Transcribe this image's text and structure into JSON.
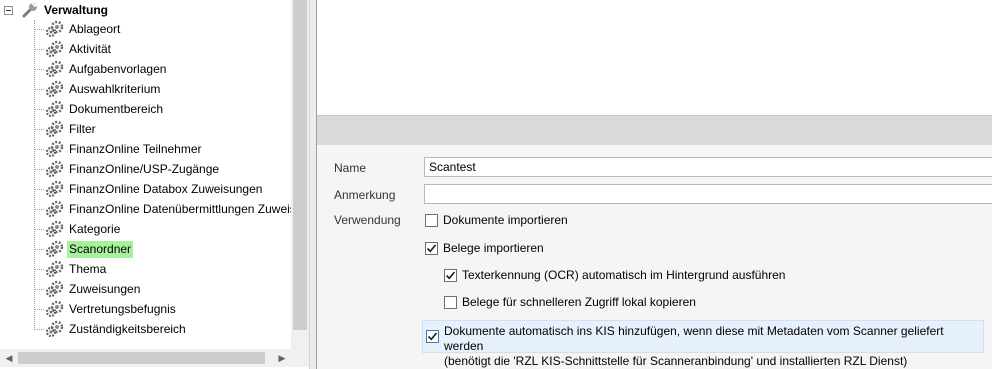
{
  "tree": {
    "root_label": "Verwaltung",
    "items": [
      {
        "label": "Ablageort"
      },
      {
        "label": "Aktivität"
      },
      {
        "label": "Aufgabenvorlagen"
      },
      {
        "label": "Auswahlkriterium"
      },
      {
        "label": "Dokumentbereich"
      },
      {
        "label": "Filter"
      },
      {
        "label": "FinanzOnline Teilnehmer"
      },
      {
        "label": "FinanzOnline/USP-Zugänge"
      },
      {
        "label": "FinanzOnline Databox Zuweisungen"
      },
      {
        "label": "FinanzOnline Datenübermittlungen Zuweisungen"
      },
      {
        "label": "Kategorie"
      },
      {
        "label": "Scanordner",
        "selected": true
      },
      {
        "label": "Thema"
      },
      {
        "label": "Zuweisungen"
      },
      {
        "label": "Vertretungsbefugnis"
      },
      {
        "label": "Zuständigkeitsbereich"
      }
    ],
    "selection_color": "#a6f19e"
  },
  "form": {
    "name_label": "Name",
    "name_value": "Scantest",
    "anmerkung_label": "Anmerkung",
    "anmerkung_value": "",
    "verwendung_label": "Verwendung",
    "options": {
      "dokumente_importieren": {
        "label": "Dokumente importieren",
        "checked": false
      },
      "belege_importieren": {
        "label": "Belege importieren",
        "checked": true
      },
      "ocr": {
        "label": "Texterkennung (OCR) automatisch im Hintergrund ausführen",
        "checked": true
      },
      "lokal_kopieren": {
        "label": "Belege für schnelleren Zugriff lokal kopieren",
        "checked": false
      },
      "kis": {
        "line1": "Dokumente automatisch ins KIS hinzufügen, wenn diese mit Metadaten vom Scanner geliefert werden",
        "line2": "(benötigt die 'RZL KIS-Schnittstelle für Scanneranbindung' und installierten RZL Dienst)",
        "checked": true
      }
    }
  },
  "colors": {
    "header_band": "#d9d9d9",
    "form_background": "#f5f5f5",
    "kis_highlight": "#e7f1fb"
  },
  "icons": {
    "root": "wrench-icon",
    "item": "gear-icon",
    "expander": "collapse-minus-icon",
    "check": "checkmark-icon"
  }
}
